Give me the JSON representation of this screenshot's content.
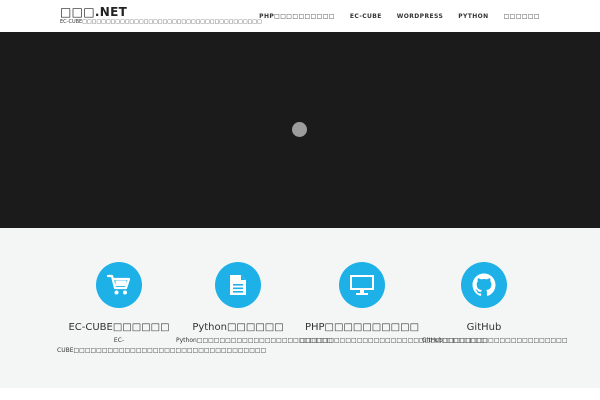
{
  "site": {
    "title": "□□□.NET",
    "description": "EC-CUBE□□□□□□□□□□□□□□□□□□□□□□□□□□□□□□□□□□□□□□"
  },
  "nav": {
    "items": [
      {
        "label": "PHP□□□□□□□□□□"
      },
      {
        "label": "EC-CUBE"
      },
      {
        "label": "WORDPRESS"
      },
      {
        "label": "PYTHON"
      },
      {
        "label": "□□□□□□"
      }
    ]
  },
  "features": [
    {
      "icon": "cart-icon",
      "title": "EC-CUBE□□□□□□",
      "desc": "EC-CUBE□□□□□□□□□□□□□□□□□□□□□□□□□□□□□□□□□□"
    },
    {
      "icon": "document-icon",
      "title": "Python□□□□□□",
      "desc": "Python□□□□□□□□□□□□□□□□□□□□□□□□"
    },
    {
      "icon": "monitor-icon",
      "title": "PHP□□□□□□□□□□",
      "desc": "□□□□□□□□□□□□□□□□□□□□□□□□□□□□□□□□□"
    },
    {
      "icon": "github-icon",
      "title": "GitHub",
      "desc": "GitHub□□□□□□□□□□□□□□□□□□□□□□"
    }
  ],
  "colors": {
    "accent": "#1db1e8",
    "hero_bg": "#1b1b1b",
    "features_bg": "#f4f6f5"
  }
}
